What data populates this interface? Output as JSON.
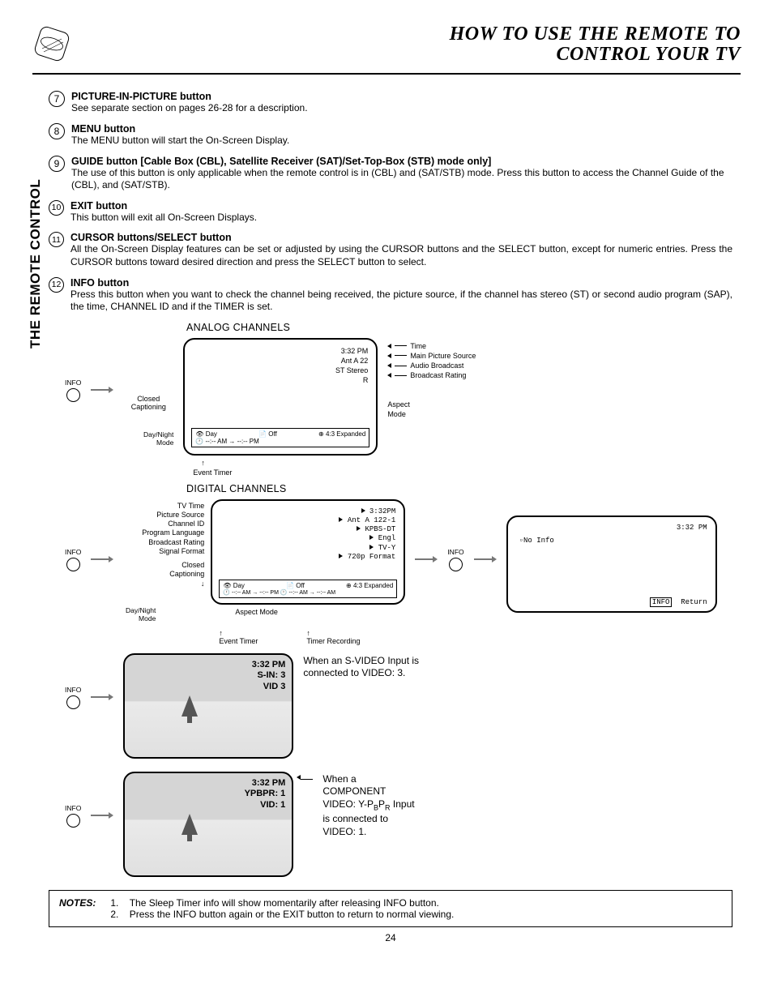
{
  "header": {
    "title_l1": "HOW TO USE THE REMOTE TO",
    "title_l2": "CONTROL YOUR TV"
  },
  "side_tab": "THE REMOTE CONTROL",
  "items": [
    {
      "num": "7",
      "title": "PICTURE-IN-PICTURE button",
      "desc": "See separate section on pages 26-28 for a description."
    },
    {
      "num": "8",
      "title": "MENU button",
      "desc": "The MENU button will start the On-Screen Display."
    },
    {
      "num": "9",
      "title": "GUIDE button [Cable Box (CBL), Satellite Receiver (SAT)/Set-Top-Box (STB) mode only]",
      "desc": "The use of this button is only applicable when the remote control is in (CBL) and (SAT/STB) mode.  Press this button to access the Channel Guide of the (CBL), and (SAT/STB)."
    },
    {
      "num": "10",
      "title": "EXIT button",
      "desc": "This button will exit all On-Screen Displays."
    },
    {
      "num": "11",
      "title": "CURSOR buttons/SELECT button",
      "desc": "All the On-Screen Display features can be set or adjusted by using the CURSOR buttons and the SELECT button, except for numeric entries.  Press the CURSOR buttons toward desired direction and press the SELECT button to select."
    },
    {
      "num": "12",
      "title": "INFO button",
      "desc": "Press this button when you want to check the channel being received, the picture source, if the channel has stereo (ST) or second audio program (SAP), the time, CHANNEL ID and if the TIMER is set."
    }
  ],
  "diagrams": {
    "analog_title": "ANALOG CHANNELS",
    "digital_title": "DIGITAL CHANNELS",
    "info_label": "INFO",
    "analog": {
      "time": "3:32 PM",
      "source": "Ant  A  22",
      "audio": "ST Stereo",
      "rating": "R",
      "callouts": {
        "time": "Time",
        "source": "Main Picture Source",
        "audio": "Audio Broadcast",
        "rating": "Broadcast Rating",
        "aspect": "Aspect",
        "mode": "Mode"
      },
      "cc_label": "Closed",
      "cc_label2": "Captioning",
      "dn_label": "Day/Night",
      "dn_label2": "Mode",
      "status_day": "Day",
      "status_off": "Off",
      "status_aspect": "4:3 Expanded",
      "status_timer": "--:-- AM",
      "status_timer2": "--:-- PM",
      "et_label": "Event Timer"
    },
    "digital": {
      "labels": [
        "TV Time",
        "Picture Source",
        "Channel ID",
        "Program Language",
        "Broadcast Rating",
        "Signal Format"
      ],
      "values": [
        "3:32PM",
        "Ant A 122-1",
        "KPBS-DT",
        "Engl",
        "TV-Y",
        "720p Format"
      ],
      "cc_label": "Closed",
      "cc_label2": "Captioning",
      "am_label": "Aspect Mode",
      "status_day": "Day",
      "status_off": "Off",
      "status_aspect": "4:3 Expanded",
      "timer1": "--:-- AM",
      "timer2": "--:-- PM",
      "timer3": "--:-- AM",
      "timer4": "--:-- AM",
      "et_label": "Event Timer",
      "tr_label": "Timer Recording",
      "big": {
        "time": "3:32 PM",
        "noinfo": "No Info",
        "ret_btn": "INFO",
        "ret_txt": "Return"
      }
    },
    "video1": {
      "time": "3:32 PM",
      "l2": "S-IN: 3",
      "l3": "VID 3",
      "desc": "When an S-VIDEO Input is connected to VIDEO: 3."
    },
    "video2": {
      "time": "3:32 PM",
      "l2": "YPBPR: 1",
      "l3": "VID: 1",
      "desc_l1": "When a",
      "desc_l2": "COMPONENT",
      "desc_l3a": "VIDEO: Y-P",
      "desc_l3b": "B",
      "desc_l3c": "P",
      "desc_l3d": "R",
      "desc_l3e": " Input",
      "desc_l4": "is connected to",
      "desc_l5": "VIDEO: 1."
    }
  },
  "notes": {
    "label": "NOTES:",
    "n1_num": "1.",
    "n1": "The Sleep Timer info will show momentarily after releasing INFO button.",
    "n2_num": "2.",
    "n2": "Press the INFO button again or the EXIT button to return to normal viewing."
  },
  "page_number": "24"
}
